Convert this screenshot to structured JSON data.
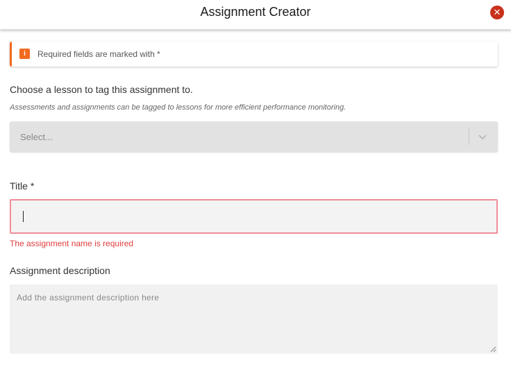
{
  "header": {
    "title": "Assignment Creator",
    "close_icon": "close-icon",
    "close_color": "#c8321c"
  },
  "notice": {
    "icon": "info-icon",
    "icon_glyph": "i",
    "text": "Required fields are marked with *",
    "accent_color": "#f06a1f"
  },
  "lesson": {
    "label": "Choose a lesson to tag this assignment to.",
    "hint": "Assessments and assignments can be tagged to lessons for more efficient performance monitoring.",
    "select_placeholder": "Select...",
    "chevron_icon": "chevron-down-icon"
  },
  "title_field": {
    "label": "Title *",
    "value": "",
    "error": "The assignment name is required",
    "error_color": "#e03c3c"
  },
  "description": {
    "label": "Assignment description",
    "placeholder": "Add the assignment description here",
    "value": ""
  }
}
